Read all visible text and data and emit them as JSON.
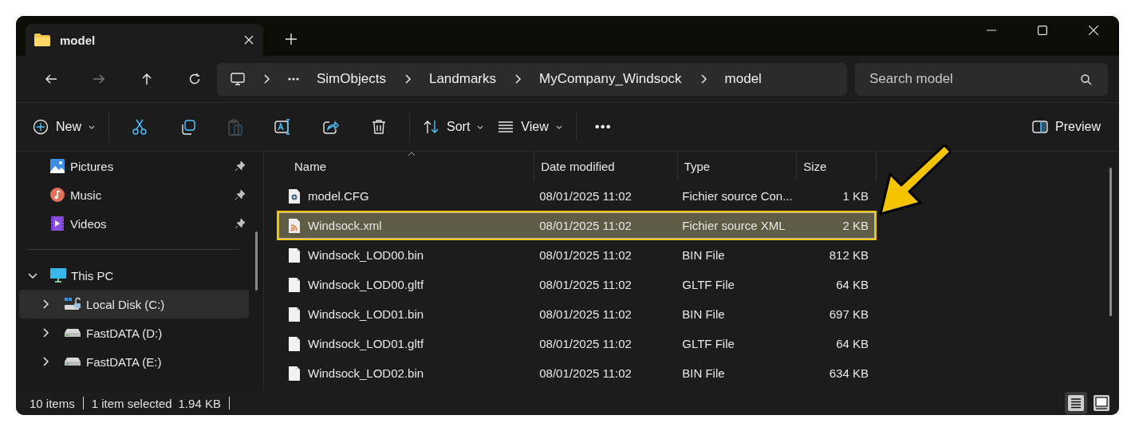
{
  "tab": {
    "title": "model"
  },
  "address": {
    "crumbs": [
      "SimObjects",
      "Landmarks",
      "MyCompany_Windsock",
      "model"
    ]
  },
  "search": {
    "placeholder": "Search model"
  },
  "toolbar": {
    "new": "New",
    "sort": "Sort",
    "view": "View",
    "more": "•••",
    "preview": "Preview",
    "actions": [
      {
        "kind": "cut",
        "disabled": false
      },
      {
        "kind": "copy",
        "disabled": false
      },
      {
        "kind": "paste",
        "disabled": true
      },
      {
        "kind": "rename",
        "disabled": false
      },
      {
        "kind": "share",
        "disabled": false
      },
      {
        "kind": "delete",
        "disabled": false
      }
    ]
  },
  "sidebar": {
    "quick_access": [
      {
        "label": "Pictures",
        "kind": "pictures",
        "pinned": true
      },
      {
        "label": "Music",
        "kind": "music",
        "pinned": true
      },
      {
        "label": "Videos",
        "kind": "videos",
        "pinned": true
      }
    ],
    "tree": [
      {
        "label": "This PC",
        "kind": "pc",
        "expanded": true,
        "selected": false,
        "children": [
          {
            "label": "Local Disk (C:)",
            "kind": "system-drive",
            "expanded": false,
            "selected": true
          },
          {
            "label": "FastDATA (D:)",
            "kind": "drive",
            "expanded": false,
            "selected": false
          },
          {
            "label": "FastDATA (E:)",
            "kind": "drive",
            "expanded": false,
            "selected": false
          }
        ]
      }
    ]
  },
  "table": {
    "columns": [
      "Name",
      "Date modified",
      "Type",
      "Size"
    ],
    "rows": [
      {
        "name": "model.CFG",
        "kind": "config",
        "date": "08/01/2025 11:02",
        "type": "Fichier source Con...",
        "size": "1 KB",
        "selected": false
      },
      {
        "name": "Windsock.xml",
        "kind": "xml",
        "date": "08/01/2025 11:02",
        "type": "Fichier source XML",
        "size": "2 KB",
        "selected": true
      },
      {
        "name": "Windsock_LOD00.bin",
        "kind": "file",
        "date": "08/01/2025 11:02",
        "type": "BIN File",
        "size": "812 KB",
        "selected": false
      },
      {
        "name": "Windsock_LOD00.gltf",
        "kind": "file",
        "date": "08/01/2025 11:02",
        "type": "GLTF File",
        "size": "64 KB",
        "selected": false
      },
      {
        "name": "Windsock_LOD01.bin",
        "kind": "file",
        "date": "08/01/2025 11:02",
        "type": "BIN File",
        "size": "697 KB",
        "selected": false
      },
      {
        "name": "Windsock_LOD01.gltf",
        "kind": "file",
        "date": "08/01/2025 11:02",
        "type": "GLTF File",
        "size": "64 KB",
        "selected": false
      },
      {
        "name": "Windsock_LOD02.bin",
        "kind": "file",
        "date": "08/01/2025 11:02",
        "type": "BIN File",
        "size": "634 KB",
        "selected": false
      }
    ]
  },
  "status_bar": {
    "items": "10 items",
    "selection": "1 item selected",
    "size": "1.94 KB",
    "views": [
      {
        "kind": "details",
        "selected": true
      },
      {
        "kind": "tiles",
        "selected": false
      }
    ]
  }
}
